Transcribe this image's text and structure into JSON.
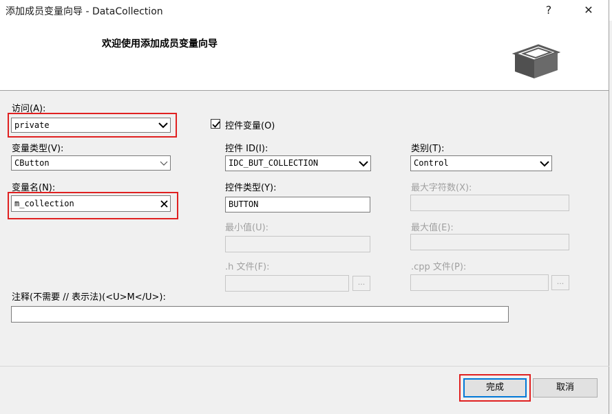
{
  "window": {
    "title": "添加成员变量向导 - DataCollection",
    "help_label": "?",
    "close_label": "✕"
  },
  "header": {
    "title": "欢迎使用添加成员变量向导"
  },
  "form": {
    "access": {
      "label": "访问(A):",
      "value": "private"
    },
    "var_type": {
      "label": "变量类型(V):",
      "value": "CButton"
    },
    "var_name": {
      "label": "变量名(N):",
      "value": "m_collection"
    },
    "control_var": {
      "label": "控件变量(O)",
      "checked": true
    },
    "control_id": {
      "label": "控件 ID(I):",
      "value": "IDC_BUT_COLLECTION"
    },
    "category": {
      "label": "类别(T):",
      "value": "Control"
    },
    "control_type": {
      "label": "控件类型(Y):",
      "value": "BUTTON"
    },
    "max_chars": {
      "label": "最大字符数(X):",
      "value": ""
    },
    "min_value": {
      "label": "最小值(U):",
      "value": ""
    },
    "max_value": {
      "label": "最大值(E):",
      "value": ""
    },
    "h_file": {
      "label": ".h 文件(F):",
      "value": "",
      "browse": "..."
    },
    "cpp_file": {
      "label": ".cpp 文件(P):",
      "value": "",
      "browse": "..."
    },
    "comment": {
      "label": "注释(不需要 // 表示法)(<U>M</U>):",
      "value": ""
    }
  },
  "buttons": {
    "finish": "完成",
    "cancel": "取消"
  },
  "colors": {
    "highlight_box": "#e02020",
    "primary_border": "#0078d7"
  }
}
